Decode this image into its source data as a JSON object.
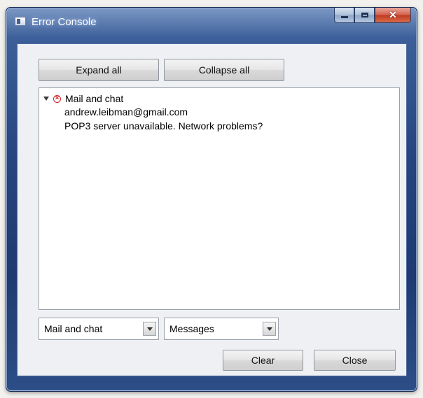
{
  "window": {
    "title": "Error Console"
  },
  "toolbar": {
    "expand_all": "Expand all",
    "collapse_all": "Collapse all"
  },
  "tree": {
    "category": "Mail and chat",
    "details": [
      "andrew.leibman@gmail.com",
      "POP3 server unavailable. Network problems?"
    ]
  },
  "filters": {
    "source_selected": "Mail and chat",
    "type_selected": "Messages"
  },
  "footer": {
    "clear": "Clear",
    "close": "Close"
  },
  "colors": {
    "error": "#d02020",
    "titlebar": "#26447f"
  }
}
